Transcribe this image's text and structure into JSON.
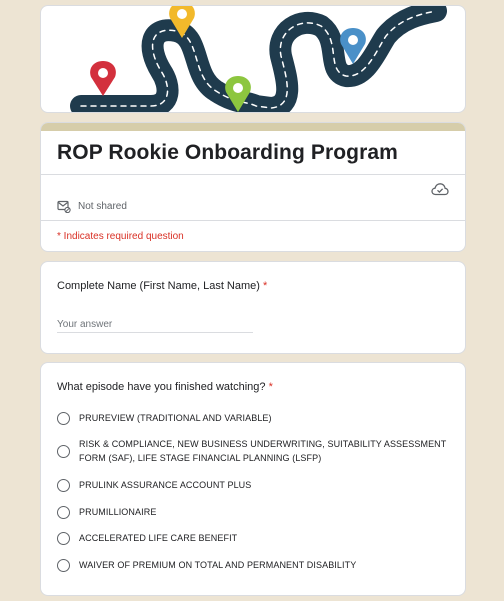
{
  "form": {
    "title": "ROP Rookie Onboarding Program",
    "sharing_status": "Not shared",
    "required_note": "* Indicates required question",
    "accent_color": "#d6cdaa",
    "background_color": "#ede4d3",
    "required_color": "#d93025"
  },
  "questions": {
    "name": {
      "label": "Complete Name (First Name, Last Name)",
      "required_mark": "*",
      "placeholder": "Your answer"
    },
    "episode": {
      "label": "What episode have you finished watching?",
      "required_mark": "*",
      "options": [
        "PRUREVIEW (TRADITIONAL AND VARIABLE)",
        "RISK & COMPLIANCE, NEW BUSINESS UNDERWRITING, SUITABILITY ASSESSMENT FORM (SAF), LIFE STAGE FINANCIAL PLANNING (LSFP)",
        "PRULINK ASSURANCE ACCOUNT PLUS",
        "PRUMILLIONAIRE",
        "ACCELERATED LIFE CARE BENEFIT",
        "WAIVER OF PREMIUM ON TOTAL AND PERMANENT DISABILITY"
      ]
    }
  },
  "icons": {
    "cloud": "cloud-saved-icon",
    "mail": "mail-not-shared-icon",
    "pins": [
      "map-pin-red",
      "map-pin-yellow",
      "map-pin-green",
      "map-pin-blue"
    ]
  }
}
